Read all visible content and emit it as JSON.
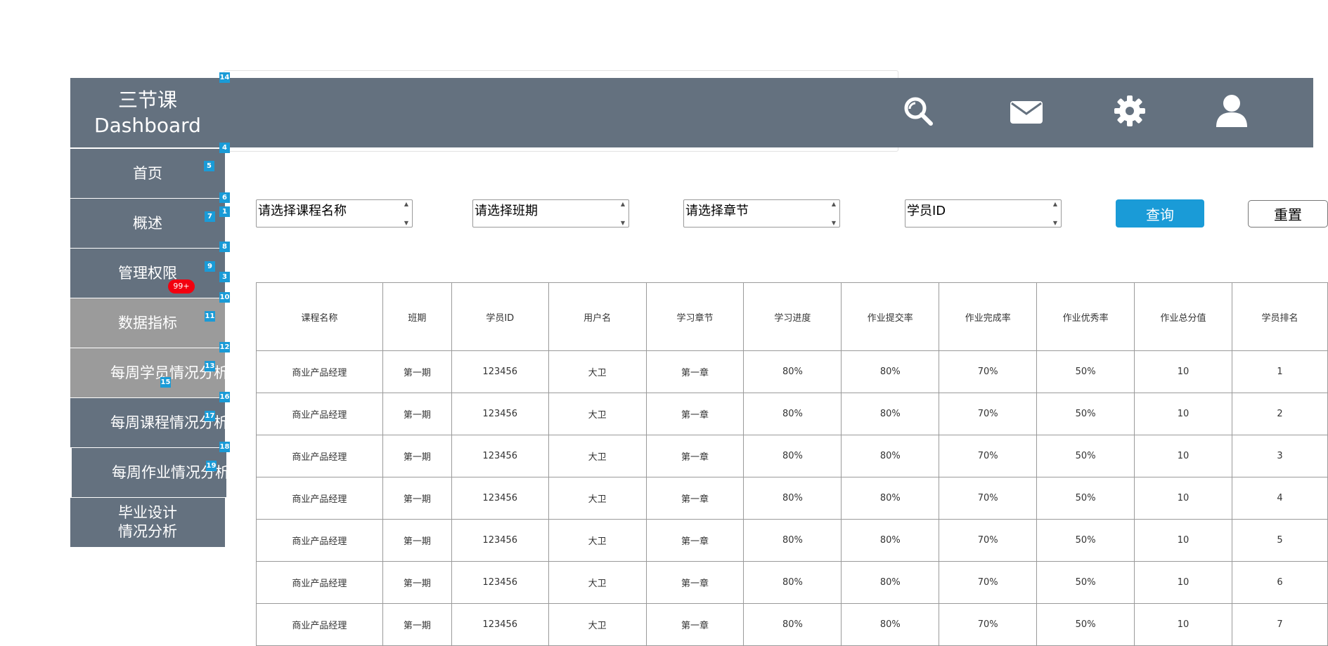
{
  "brand": {
    "line1": "三节课",
    "line2": "Dashboard"
  },
  "header": {
    "icons": [
      "search-icon",
      "mail-icon",
      "gear-icon",
      "user-icon"
    ]
  },
  "sidebar": {
    "items": [
      {
        "label": "首页"
      },
      {
        "label": "概述"
      },
      {
        "label": "管理权限"
      },
      {
        "label": "数据指标"
      },
      {
        "label": "每周学员情况分析"
      },
      {
        "label": "每周课程情况分析"
      },
      {
        "label": "每周作业情况分析"
      },
      {
        "label_line1": "毕业设计",
        "label_line2": "情况分析"
      }
    ],
    "badge": "99+"
  },
  "markers": [
    "14",
    "4",
    "5",
    "6",
    "1",
    "7",
    "8",
    "9",
    "3",
    "10",
    "11",
    "12",
    "13",
    "15",
    "16",
    "17",
    "18",
    "19"
  ],
  "filters": {
    "course": "请选择课程名称",
    "class": "请选择班期",
    "chapter": "请选择章节",
    "student_id": "学员ID",
    "query_label": "查询",
    "reset_label": "重置"
  },
  "table": {
    "headers": [
      "课程名称",
      "班期",
      "学员ID",
      "用户名",
      "学习章节",
      "学习进度",
      "作业提交率",
      "作业完成率",
      "作业优秀率",
      "作业总分值",
      "学员排名"
    ],
    "rows": [
      [
        "商业产品经理",
        "第一期",
        "123456",
        "大卫",
        "第一章",
        "80%",
        "80%",
        "70%",
        "50%",
        "10",
        "1"
      ],
      [
        "商业产品经理",
        "第一期",
        "123456",
        "大卫",
        "第一章",
        "80%",
        "80%",
        "70%",
        "50%",
        "10",
        "2"
      ],
      [
        "商业产品经理",
        "第一期",
        "123456",
        "大卫",
        "第一章",
        "80%",
        "80%",
        "70%",
        "50%",
        "10",
        "3"
      ],
      [
        "商业产品经理",
        "第一期",
        "123456",
        "大卫",
        "第一章",
        "80%",
        "80%",
        "70%",
        "50%",
        "10",
        "4"
      ],
      [
        "商业产品经理",
        "第一期",
        "123456",
        "大卫",
        "第一章",
        "80%",
        "80%",
        "70%",
        "50%",
        "10",
        "5"
      ],
      [
        "商业产品经理",
        "第一期",
        "123456",
        "大卫",
        "第一章",
        "80%",
        "80%",
        "70%",
        "50%",
        "10",
        "6"
      ],
      [
        "商业产品经理",
        "第一期",
        "123456",
        "大卫",
        "第一章",
        "80%",
        "80%",
        "70%",
        "50%",
        "10",
        "7"
      ]
    ]
  },
  "colors": {
    "header_bg": "#64717f",
    "nav_selected_bg": "#9b9b9b",
    "accent": "#1a9bd7",
    "badge": "#f2000f"
  }
}
